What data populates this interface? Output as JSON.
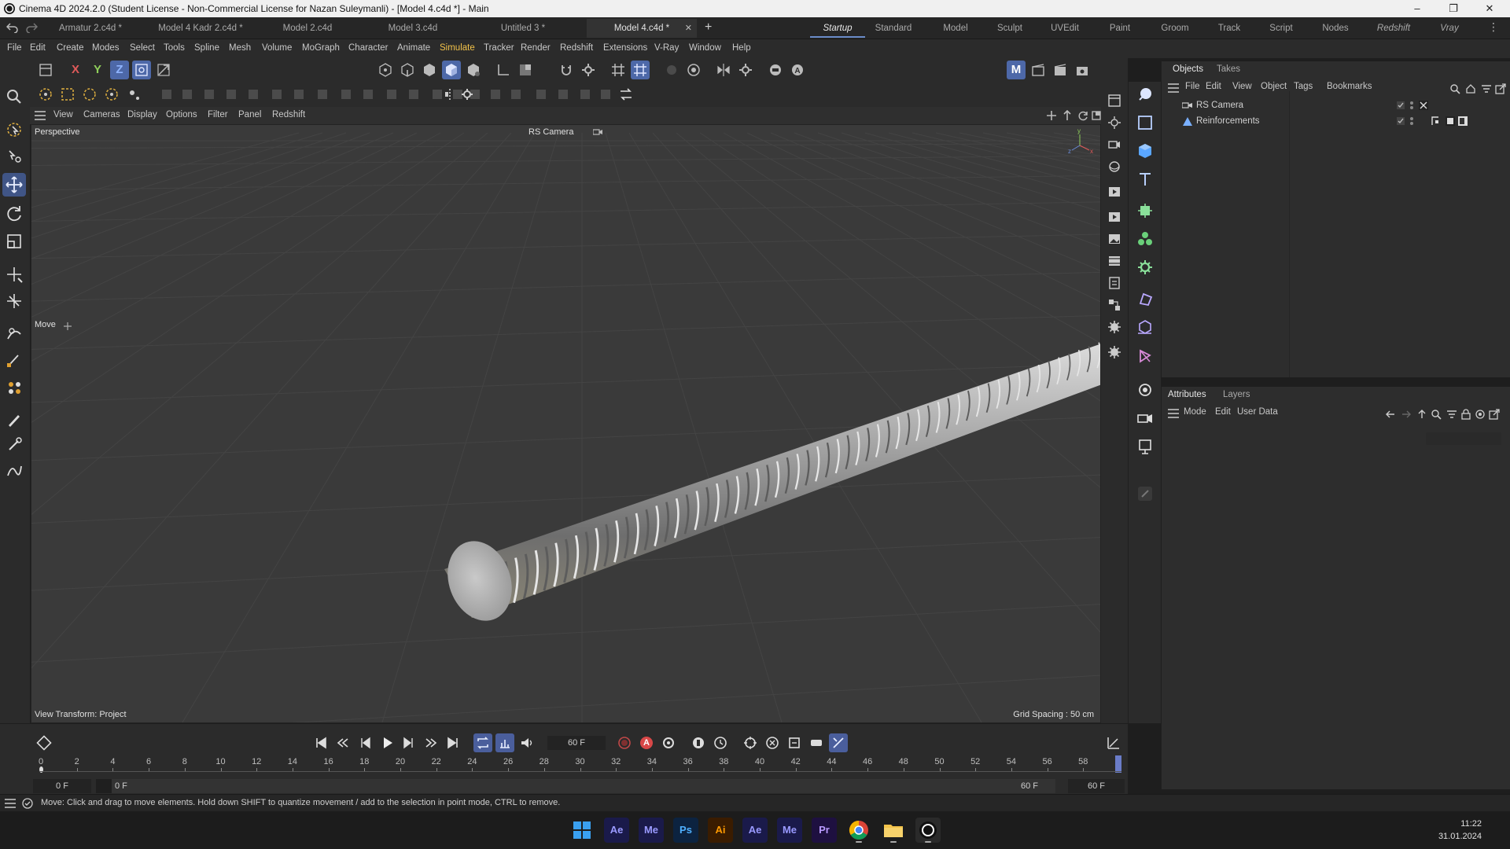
{
  "window": {
    "title": "Cinema 4D 2024.2.0 (Student License - Non-Commercial License for Nazan Suleymanli) - [Model 4.c4d *] - Main",
    "controls": [
      "–",
      "❐",
      "✕"
    ]
  },
  "doc_tabs": [
    {
      "label": "Armatur 2.c4d *",
      "active": false
    },
    {
      "label": "Model 4 Kadr 2.c4d *",
      "active": false
    },
    {
      "label": "Model 2.c4d",
      "active": false
    },
    {
      "label": "Model 3.c4d",
      "active": false
    },
    {
      "label": "Untitled 3 *",
      "active": false
    },
    {
      "label": "Model 4.c4d *",
      "active": true
    }
  ],
  "doc_tab_add": "+",
  "doc_tab_close": "✕",
  "layout_tabs": [
    {
      "label": "Startup",
      "active": true,
      "italic": true
    },
    {
      "label": "Standard",
      "active": false,
      "italic": false
    },
    {
      "label": "Model",
      "active": false,
      "italic": false
    },
    {
      "label": "Sculpt",
      "active": false,
      "italic": false
    },
    {
      "label": "UVEdit",
      "active": false,
      "italic": false
    },
    {
      "label": "Paint",
      "active": false,
      "italic": false
    },
    {
      "label": "Groom",
      "active": false,
      "italic": false
    },
    {
      "label": "Track",
      "active": false,
      "italic": false
    },
    {
      "label": "Script",
      "active": false,
      "italic": false
    },
    {
      "label": "Nodes",
      "active": false,
      "italic": false
    },
    {
      "label": "Redshift",
      "active": false,
      "italic": true
    },
    {
      "label": "Vray",
      "active": false,
      "italic": true
    }
  ],
  "menu": [
    "File",
    "Edit",
    "Create",
    "Modes",
    "Select",
    "Tools",
    "Spline",
    "Mesh",
    "Volume",
    "MoGraph",
    "Character",
    "Animate",
    "Simulate",
    "Tracker",
    "Render",
    "Redshift",
    "Extensions",
    "V-Ray",
    "Window",
    "Help"
  ],
  "menu_highlight": "Simulate",
  "axis_buttons": {
    "x": "X",
    "y": "Y",
    "z": "Z"
  },
  "viewport": {
    "menu": [
      "View",
      "Cameras",
      "Display",
      "Options",
      "Filter",
      "Panel",
      "Redshift"
    ],
    "name": "Perspective",
    "camera": "RS Camera",
    "tool_label": "Move",
    "view_transform": "View Transform: Project",
    "grid_spacing": "Grid Spacing : 50 cm",
    "bg_color": "#3a3a3a",
    "grid_color": "#444444"
  },
  "objects_panel": {
    "tabs": [
      {
        "label": "Objects",
        "active": true
      },
      {
        "label": "Takes",
        "active": false
      }
    ],
    "menu": [
      "File",
      "Edit",
      "View",
      "Object",
      "Tags",
      "Bookmarks"
    ],
    "items": [
      {
        "name": "RS Camera",
        "icon": "camera-icon"
      },
      {
        "name": "Reinforcements",
        "icon": "null-object-icon"
      }
    ]
  },
  "attributes_panel": {
    "tabs": [
      {
        "label": "Attributes",
        "active": true
      },
      {
        "label": "Layers",
        "active": false
      }
    ],
    "menu": [
      "Mode",
      "Edit",
      "User Data"
    ]
  },
  "timeline": {
    "current_frame": "60 F",
    "ruler": [
      "0",
      "2",
      "4",
      "6",
      "8",
      "10",
      "12",
      "14",
      "16",
      "18",
      "20",
      "22",
      "24",
      "26",
      "28",
      "30",
      "32",
      "34",
      "36",
      "38",
      "40",
      "42",
      "44",
      "46",
      "48",
      "50",
      "52",
      "54",
      "56",
      "58"
    ],
    "start_field": "0 F",
    "start_field2": "0 F",
    "end_field": "60 F",
    "end_field2": "60 F",
    "record_label": "A"
  },
  "status": {
    "message": "Move: Click and drag to move elements. Hold down SHIFT to quantize movement / add to the selection in point mode, CTRL to remove."
  },
  "taskbar": {
    "apps": [
      {
        "label": "",
        "icon": "windows-start-icon",
        "color": "#3aa0f0",
        "bg": "transparent"
      },
      {
        "label": "Ae",
        "icon": "after-effects-icon",
        "color": "#9a9aff",
        "bg": "#1a1a4a"
      },
      {
        "label": "Me",
        "icon": "media-encoder-icon",
        "color": "#9a9aff",
        "bg": "#1a1a4a"
      },
      {
        "label": "Ps",
        "icon": "photoshop-icon",
        "color": "#4fb0ff",
        "bg": "#0c2340"
      },
      {
        "label": "Ai",
        "icon": "illustrator-icon",
        "color": "#ff9a00",
        "bg": "#3a1c00"
      },
      {
        "label": "Ae",
        "icon": "after-effects-icon",
        "color": "#9a9aff",
        "bg": "#1a1a4a"
      },
      {
        "label": "Me",
        "icon": "media-encoder-icon",
        "color": "#9a9aff",
        "bg": "#1a1a4a"
      },
      {
        "label": "Pr",
        "icon": "premiere-icon",
        "color": "#b99aff",
        "bg": "#1e1040"
      },
      {
        "label": "",
        "icon": "chrome-icon",
        "color": "#ffffff",
        "bg": "transparent"
      },
      {
        "label": "",
        "icon": "folder-icon",
        "color": "#f3c34a",
        "bg": "transparent"
      },
      {
        "label": "",
        "icon": "cinema4d-icon",
        "color": "#ffffff",
        "bg": "#2a2a2a"
      }
    ],
    "time": "11:22",
    "date": "31.01.2024"
  }
}
